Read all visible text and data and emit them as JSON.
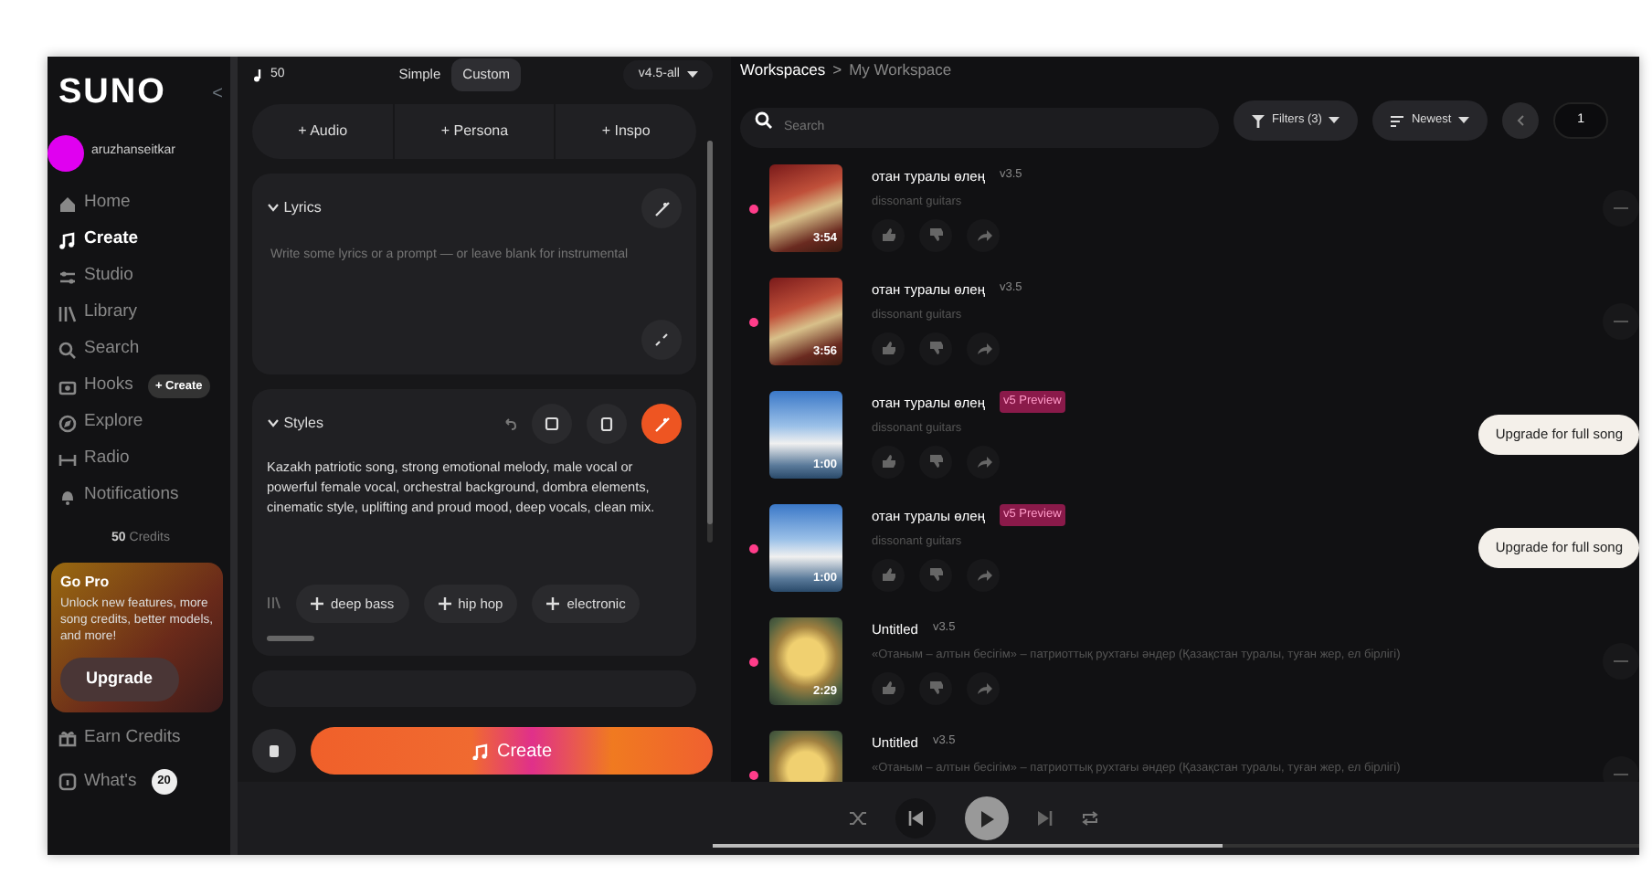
{
  "sidebar": {
    "logo": "SUNO",
    "collapse": "<",
    "user": {
      "name": "aruzhanseitkar"
    },
    "nav": [
      {
        "label": "Home",
        "selected": false
      },
      {
        "label": "Create",
        "selected": true
      },
      {
        "label": "Studio",
        "selected": false
      },
      {
        "label": "Library",
        "selected": false
      },
      {
        "label": "Search",
        "selected": false
      },
      {
        "label": "Hooks",
        "selected": false,
        "badge": "+ Create"
      },
      {
        "label": "Explore",
        "selected": false
      },
      {
        "label": "Radio",
        "selected": false
      },
      {
        "label": "Notifications",
        "selected": false
      }
    ],
    "credits": {
      "amount": "50",
      "label": "Credits"
    },
    "promo": {
      "title": "Go Pro",
      "text": "Unlock new features, more song credits, better models, and more!",
      "button": "Upgrade"
    },
    "bottom": [
      {
        "label": "Earn Credits"
      },
      {
        "label": "What's",
        "badge": "20"
      }
    ]
  },
  "create": {
    "credits": "50",
    "modes": [
      {
        "label": "Simple",
        "selected": false
      },
      {
        "label": "Custom",
        "selected": true
      }
    ],
    "model": "v4.5-all",
    "add_buttons": [
      "+ Audio",
      "+ Persona",
      "+ Inspo"
    ],
    "lyrics": {
      "title": "Lyrics",
      "placeholder": "Write some lyrics or a prompt — or leave blank for instrumental"
    },
    "styles": {
      "title": "Styles",
      "text": "Kazakh patriotic song, strong emotional melody, male vocal or powerful female vocal, orchestral background, dombra elements, cinematic style, uplifting and proud mood, deep vocals, clean mix.",
      "tags": [
        "deep bass",
        "hip hop",
        "electronic"
      ]
    },
    "create_button": "Create"
  },
  "workspace": {
    "breadcrumb": [
      "Workspaces",
      "My Workspace"
    ],
    "breadcrumb_separator": ">",
    "search": {
      "placeholder": "Search"
    },
    "filters": "Filters (3)",
    "sort": "Newest",
    "page": "1",
    "songs": [
      {
        "title": "отан туралы өлең",
        "version": "v3.5",
        "kind": "standard",
        "subtitle": "dissonant guitars",
        "duration": "3:54",
        "new": true
      },
      {
        "title": "отан туралы өлең",
        "version": "v3.5",
        "kind": "standard",
        "subtitle": "dissonant guitars",
        "duration": "3:56",
        "new": true
      },
      {
        "title": "отан туралы өлең",
        "version": "v5 Preview",
        "kind": "preview",
        "subtitle": "dissonant guitars",
        "duration": "1:00",
        "new": false,
        "action": "Upgrade for full song"
      },
      {
        "title": "отан туралы өлең",
        "version": "v5 Preview",
        "kind": "preview",
        "subtitle": "dissonant guitars",
        "duration": "1:00",
        "new": true,
        "action": "Upgrade for full song"
      },
      {
        "title": "Untitled",
        "version": "v3.5",
        "kind": "standard",
        "subtitle": "«Отаным – алтын бесігім» – патриоттық рухтағы әндер (Қазақстан туралы, туған жер, ел бірлігі)",
        "duration": "2:29",
        "new": true
      },
      {
        "title": "Untitled",
        "version": "v3.5",
        "kind": "standard",
        "subtitle": "«Отаным – алтын бесігім» – патриоттық рухтағы әндер (Қазақстан туралы, туған жер, ел бірлігі)",
        "new": true
      }
    ]
  },
  "player": {
    "level": 0.55
  }
}
